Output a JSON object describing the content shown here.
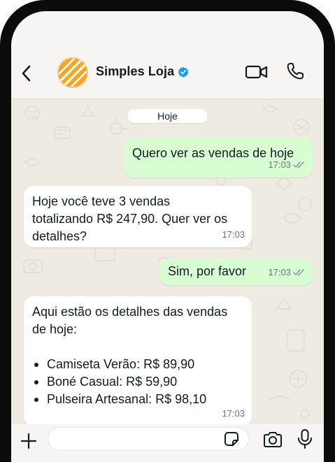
{
  "header": {
    "contact_name": "Simples Loja",
    "verified": true
  },
  "chat": {
    "date_chip": "Hoje",
    "messages": [
      {
        "direction": "out",
        "text": "Quero ver as vendas de hoje",
        "time": "17:03",
        "status": "read"
      },
      {
        "direction": "in",
        "text_lines": [
          "Hoje você teve 3 vendas",
          "totalizando R$ 247,90. Quer ver os",
          "detalhes?"
        ],
        "time": "17:03"
      },
      {
        "direction": "out",
        "text": "Sim, por favor",
        "time": "17:03",
        "status": "read"
      },
      {
        "direction": "in",
        "text_lines": [
          "Aqui estão os detalhes das vendas",
          "de hoje:"
        ],
        "items": [
          "Camiseta Verão: R$ 89,90",
          "Boné Casual: R$ 59,90",
          "Pulseira Artesanal: R$ 98,10"
        ],
        "time": "17:03"
      }
    ]
  },
  "input": {
    "value": "",
    "placeholder": ""
  },
  "icons": {
    "back": "chevron-left-icon",
    "avatar": "store-logo-icon",
    "verified": "verified-badge-icon",
    "video": "video-camera-icon",
    "call": "phone-icon",
    "plus": "plus-icon",
    "sticker": "sticker-icon",
    "camera": "camera-icon",
    "mic": "microphone-icon",
    "read": "double-check-icon"
  },
  "colors": {
    "outgoing_bubble": "#d9fdd3",
    "incoming_bubble": "#ffffff",
    "chat_background": "#efeae2",
    "verified": "#1d9bf0",
    "read_ticks": "#8696a0",
    "avatar_orange": "#f6a623"
  }
}
